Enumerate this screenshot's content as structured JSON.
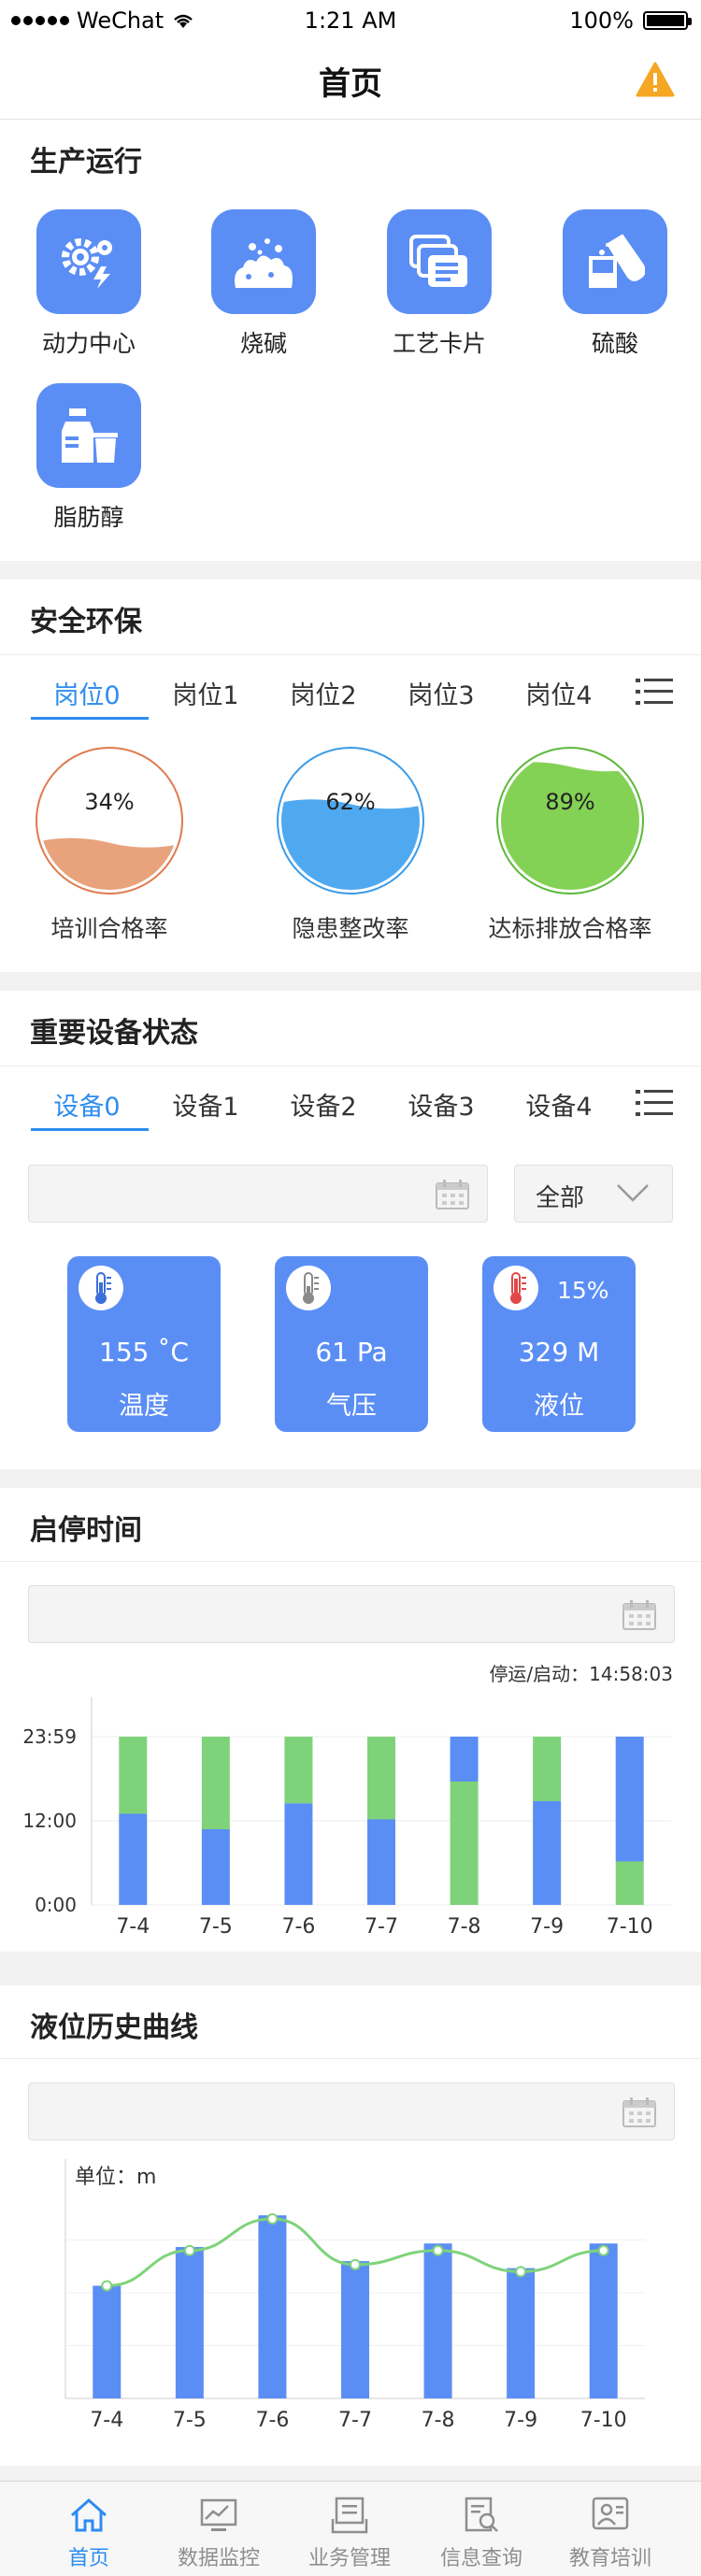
{
  "status_bar": {
    "carrier": "WeChat",
    "time": "1:21 AM",
    "battery": "100%"
  },
  "nav": {
    "title": "首页",
    "warning_icon": "warning-icon"
  },
  "production": {
    "title": "生产运行",
    "items": [
      {
        "label": "动力中心",
        "icon": "gears-icon"
      },
      {
        "label": "烧碱",
        "icon": "caustic-soda-icon"
      },
      {
        "label": "工艺卡片",
        "icon": "cards-icon"
      },
      {
        "label": "硫酸",
        "icon": "flask-icon"
      },
      {
        "label": "脂肪醇",
        "icon": "bottles-icon"
      }
    ]
  },
  "safety": {
    "title": "安全环保",
    "tabs": [
      "岗位0",
      "岗位1",
      "岗位2",
      "岗位3",
      "岗位4"
    ],
    "active_tab": 0,
    "gauges": [
      {
        "label": "培训合格率",
        "value": "34%",
        "percent": 34,
        "color": "#e07a4f",
        "fill": "#e8a37c"
      },
      {
        "label": "隐患整改率",
        "value": "62%",
        "percent": 62,
        "color": "#3a9be8",
        "fill": "#4fa9f0"
      },
      {
        "label": "达标排放合格率",
        "value": "89%",
        "percent": 89,
        "color": "#5cb83a",
        "fill": "#84d255"
      }
    ]
  },
  "equipment": {
    "title": "重要设备状态",
    "tabs": [
      "设备0",
      "设备1",
      "设备2",
      "设备3",
      "设备4"
    ],
    "active_tab": 0,
    "filter_value": "全部",
    "cards": [
      {
        "value": "155 ˚C",
        "name": "温度",
        "extra": "",
        "therm_color": "#3b6fd9"
      },
      {
        "value": "61 Pa",
        "name": "气压",
        "extra": "",
        "therm_color": "#8a8a8a"
      },
      {
        "value": "329 M",
        "name": "液位",
        "extra": "15%",
        "therm_color": "#e04848"
      }
    ]
  },
  "startstop": {
    "title": "启停时间",
    "chart_data": {
      "type": "bar",
      "annotation": "停运/启动：14:58:03",
      "categories": [
        "7-4",
        "7-5",
        "7-6",
        "7-7",
        "7-8",
        "7-9",
        "7-10"
      ],
      "y_ticks": [
        "23:59",
        "12:00",
        "0:00"
      ],
      "ylim": [
        0,
        24
      ],
      "series": [
        {
          "color": "#5b8ef5",
          "segments": [
            [
              0,
              13
            ],
            [
              0,
              10.8
            ],
            [
              0,
              14.5
            ],
            [
              0,
              12.2
            ],
            [
              17.6,
              24
            ],
            [
              0,
              14.8
            ],
            [
              6.2,
              24
            ]
          ]
        },
        {
          "color": "#7ed37a",
          "segments": [
            [
              13,
              24
            ],
            [
              10.8,
              24
            ],
            [
              14.5,
              24
            ],
            [
              12.2,
              24
            ],
            [
              0,
              17.6
            ],
            [
              14.8,
              24
            ],
            [
              0,
              6.2
            ]
          ]
        }
      ]
    }
  },
  "liquid": {
    "title": "液位历史曲线",
    "chart_data": {
      "type": "bar",
      "unit_label": "单位：m",
      "categories": [
        "7-4",
        "7-5",
        "7-6",
        "7-7",
        "7-8",
        "7-9",
        "7-10"
      ],
      "values": [
        3.2,
        4.3,
        5.2,
        3.9,
        4.4,
        3.7,
        4.4
      ],
      "line": [
        3.2,
        4.2,
        5.1,
        3.8,
        4.2,
        3.6,
        4.2
      ],
      "ylim": [
        0,
        6
      ],
      "bar_color": "#5b8ef5",
      "line_color": "#7ed37a"
    }
  },
  "tabbar": {
    "items": [
      {
        "label": "首页",
        "icon": "home-icon",
        "active": true
      },
      {
        "label": "数据监控",
        "icon": "monitor-icon",
        "active": false
      },
      {
        "label": "业务管理",
        "icon": "business-icon",
        "active": false
      },
      {
        "label": "信息查询",
        "icon": "search-doc-icon",
        "active": false
      },
      {
        "label": "教育培训",
        "icon": "training-icon",
        "active": false
      }
    ]
  }
}
